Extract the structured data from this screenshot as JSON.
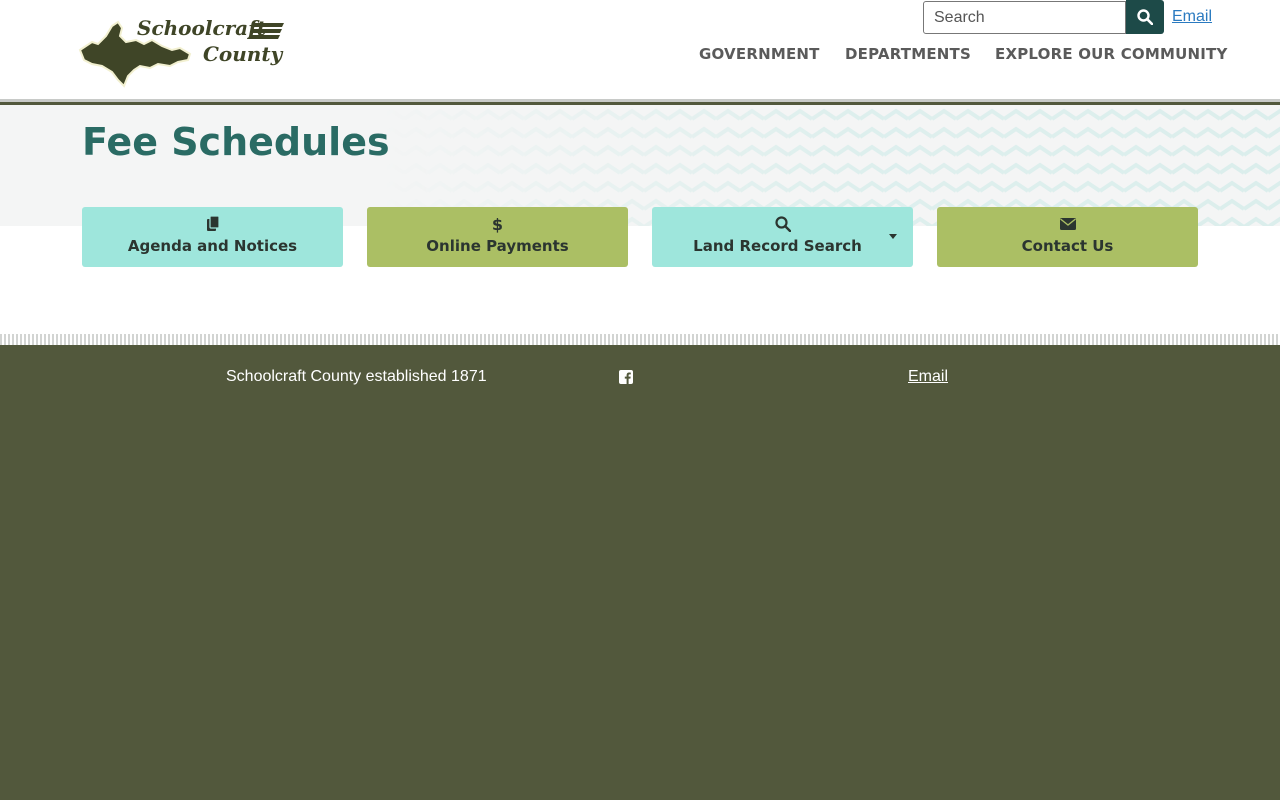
{
  "header": {
    "logo_line1": "Schoolcraft",
    "logo_line2": "County",
    "search_placeholder": "Search",
    "email_link": "Email"
  },
  "nav": {
    "items": [
      "GOVERNMENT",
      "DEPARTMENTS",
      "EXPLORE OUR COMMUNITY"
    ]
  },
  "page": {
    "title": "Fee Schedules"
  },
  "quick_links": [
    {
      "label": "Agenda and Notices",
      "icon": "clipboard-icon",
      "color": "#9ee6dc"
    },
    {
      "label": "Online Payments",
      "icon": "dollar-icon",
      "color": "#abbf64"
    },
    {
      "label": "Land Record Search",
      "icon": "search-icon",
      "color": "#9ee6dc",
      "dropdown": true
    },
    {
      "label": "Contact Us",
      "icon": "envelope-icon",
      "color": "#abbf64"
    }
  ],
  "footer": {
    "established": "Schoolcraft County established 1871",
    "social_icon": "facebook-icon",
    "email_link": "Email"
  },
  "colors": {
    "brand_dark": "#1d4a48",
    "title": "#2a6b64",
    "footer_bg": "#52583c",
    "teal": "#9ee6dc",
    "olive": "#abbf64"
  }
}
